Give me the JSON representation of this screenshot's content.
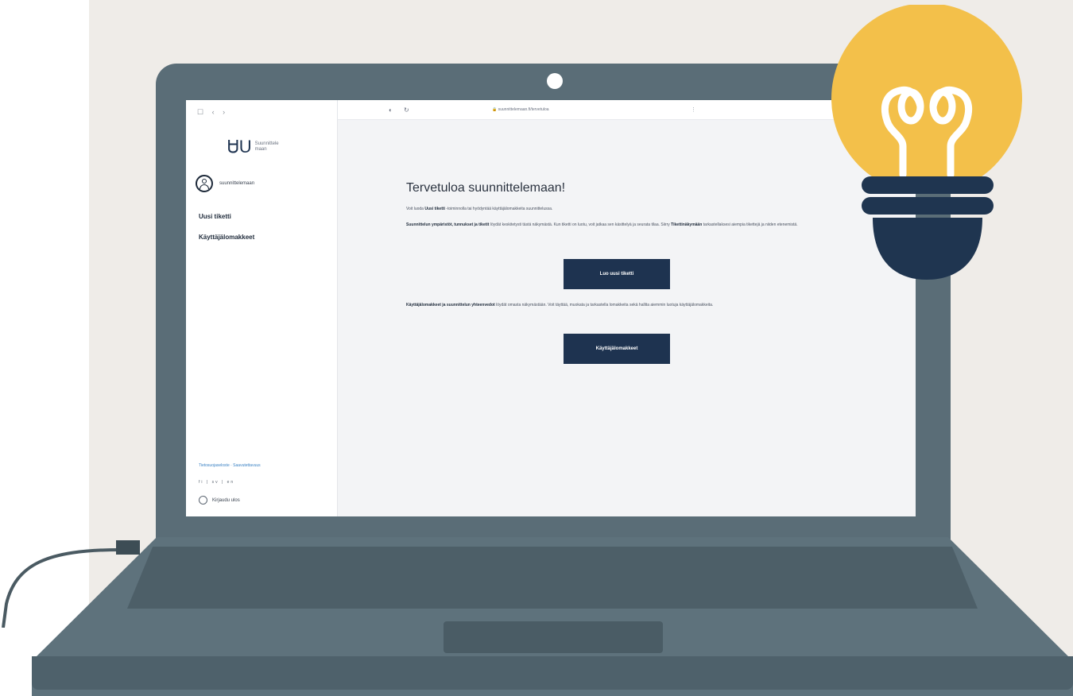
{
  "browser": {
    "toolbar_left": "☐ ‹ ›",
    "toolbar_icons": "◐ ↻",
    "url": "🔒 suunnittelemaan.fi/tervetuloa",
    "menu": "⋮"
  },
  "sidebar": {
    "logo_mark": "ᏌU",
    "logo_text": "Suunnittele maan",
    "user_name": "suunnittelemaan",
    "items": [
      {
        "label": "Uusi tiketti"
      },
      {
        "label": "Käyttäjälomakkeet"
      }
    ],
    "footer_link": "Tietosuojaseloste · Saavutettavuus",
    "footer_small": "fi | sv | en",
    "logout_label": "Kirjaudu ulos"
  },
  "main": {
    "title": "Tervetuloa suunnittelemaan!",
    "intro_pre": "Voit luoda ",
    "intro_bold": "Uusi tiketti",
    "intro_post": " -toiminnolla tai hyödyntää käyttäjälomakkeita suunnittelussa.",
    "para1_bold": "Suunnittelun ympäristöt, tunnukset ja tiketit",
    "para1_text": " löydät keskitetysti tästä näkymästä. Kun tiketti on luotu, voit jatkaa sen käsittelyä ja seurata tilaa. Siirry ",
    "para1_bold2": "Tikettinäkymään",
    "para1_text2": " tarkastellaksesi aiempia tikettejä ja niiden etenemistä.",
    "button1": "Luo uusi tiketti",
    "para2_bold": "Käyttäjälomakkeet ja suunnittelun yhteenvedot",
    "para2_text": " löydät omasta näkymästään. Voit täyttää, muokata ja tarkastella lomakkeita sekä hallita aiemmin luotuja käyttäjälomakkeita.",
    "button2": "Käyttäjälomakkeet"
  },
  "colors": {
    "accent_navy": "#1e3350",
    "laptop": "#5a6d77",
    "bulb_yellow": "#f3c04a",
    "bulb_base": "#1f3550",
    "background": "#efece8"
  }
}
